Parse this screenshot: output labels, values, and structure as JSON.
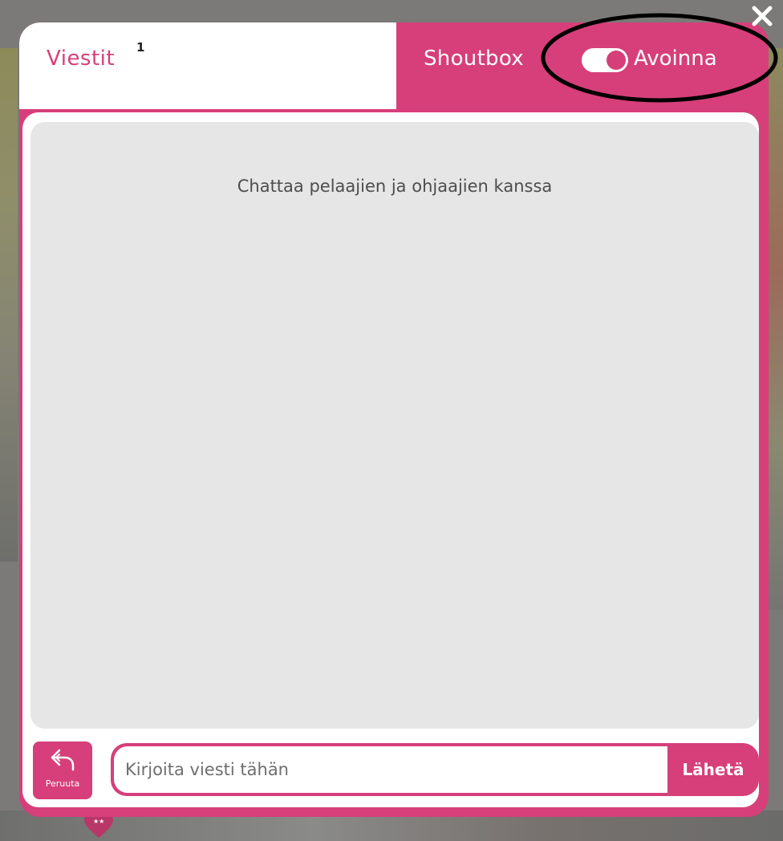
{
  "tabs": {
    "messages": {
      "label": "Viestit",
      "badge": "1"
    },
    "shoutbox": {
      "label": "Shoutbox"
    }
  },
  "toggle": {
    "label": "Avoinna",
    "state": "on"
  },
  "chat": {
    "empty_text": "Chattaa pelaajien ja ohjaajien kanssa"
  },
  "composer": {
    "cancel_label": "Peruuta",
    "input_placeholder": "Kirjoita viesti tähän",
    "input_value": "",
    "send_label": "Lähetä"
  },
  "icons": {
    "close": "close-icon",
    "cancel": "reply-arrow-icon",
    "background": "heart-icon"
  },
  "colors": {
    "accent": "#d63f7a",
    "chat_bg": "#e6e6e6",
    "overlay": "#7b7a78"
  }
}
